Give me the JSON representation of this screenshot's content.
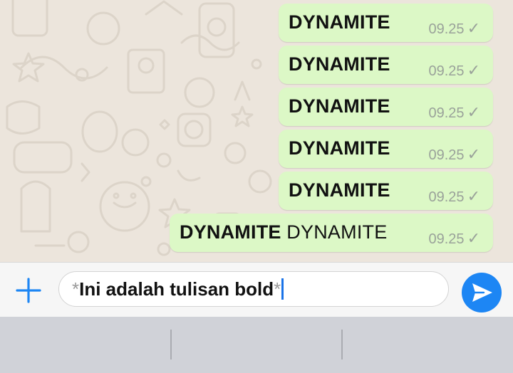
{
  "chat": {
    "messages": [
      {
        "bold": "DYNAMITE",
        "normal": "",
        "time": "09.25",
        "status": "sent-check-icon"
      },
      {
        "bold": "DYNAMITE",
        "normal": "",
        "time": "09.25",
        "status": "sent-check-icon"
      },
      {
        "bold": "DYNAMITE",
        "normal": "",
        "time": "09.25",
        "status": "sent-check-icon"
      },
      {
        "bold": "DYNAMITE",
        "normal": "",
        "time": "09.25",
        "status": "sent-check-icon"
      },
      {
        "bold": "DYNAMITE",
        "normal": "",
        "time": "09.25",
        "status": "sent-check-icon"
      },
      {
        "bold": "DYNAMITE",
        "normal": " DYNAMITE",
        "time": "09.25",
        "status": "sent-check-icon"
      }
    ]
  },
  "composer": {
    "asterisk_open": "*",
    "text": "Ini adalah tulisan bold",
    "asterisk_close": "*",
    "plus_icon": "plus-icon",
    "send_icon": "send-icon"
  },
  "colors": {
    "bubble_out": "#dcf8c6",
    "chat_bg": "#ece5dc",
    "accent": "#1d86f4"
  }
}
